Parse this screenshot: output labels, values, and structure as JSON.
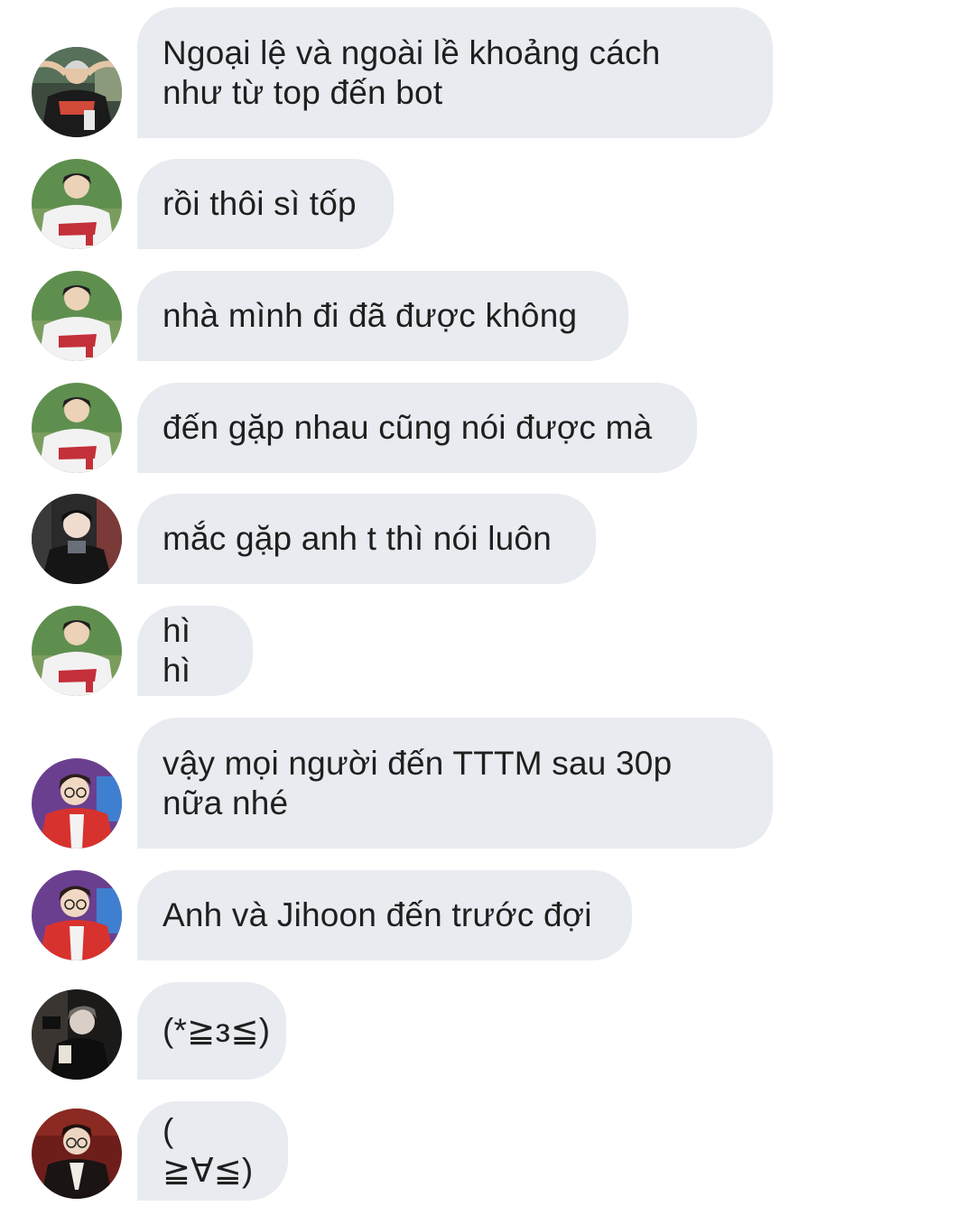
{
  "conversation": {
    "messages": [
      {
        "avatar": "avatar-beanie-jersey",
        "text": "Ngoại lệ và ngoài lề khoảng cách\nnhư từ top đến bot"
      },
      {
        "avatar": "avatar-baseball-jersey",
        "text": "rồi thôi sì tốp"
      },
      {
        "avatar": "avatar-baseball-jersey",
        "text": "nhà mình đi đã được không"
      },
      {
        "avatar": "avatar-baseball-jersey",
        "text": "đến gặp nhau cũng nói được mà"
      },
      {
        "avatar": "avatar-dark-coat",
        "text": "mắc gặp anh t thì nói luôn"
      },
      {
        "avatar": "avatar-baseball-jersey",
        "text": "hì hì"
      },
      {
        "avatar": "avatar-red-jacket-glasses",
        "text": "vậy mọi người đến TTTM sau 30p\nnữa nhé"
      },
      {
        "avatar": "avatar-red-jacket-glasses",
        "text": "Anh và Jihoon đến trước đợi"
      },
      {
        "avatar": "avatar-dark-photo",
        "text": "(*≧з≦)"
      },
      {
        "avatar": "avatar-suit-red-background",
        "text": "( ≧∀≦)"
      }
    ]
  },
  "theme": {
    "bubble_color": "#e8ebef",
    "text_color": "#1f1f1f",
    "background": "#ffffff"
  }
}
